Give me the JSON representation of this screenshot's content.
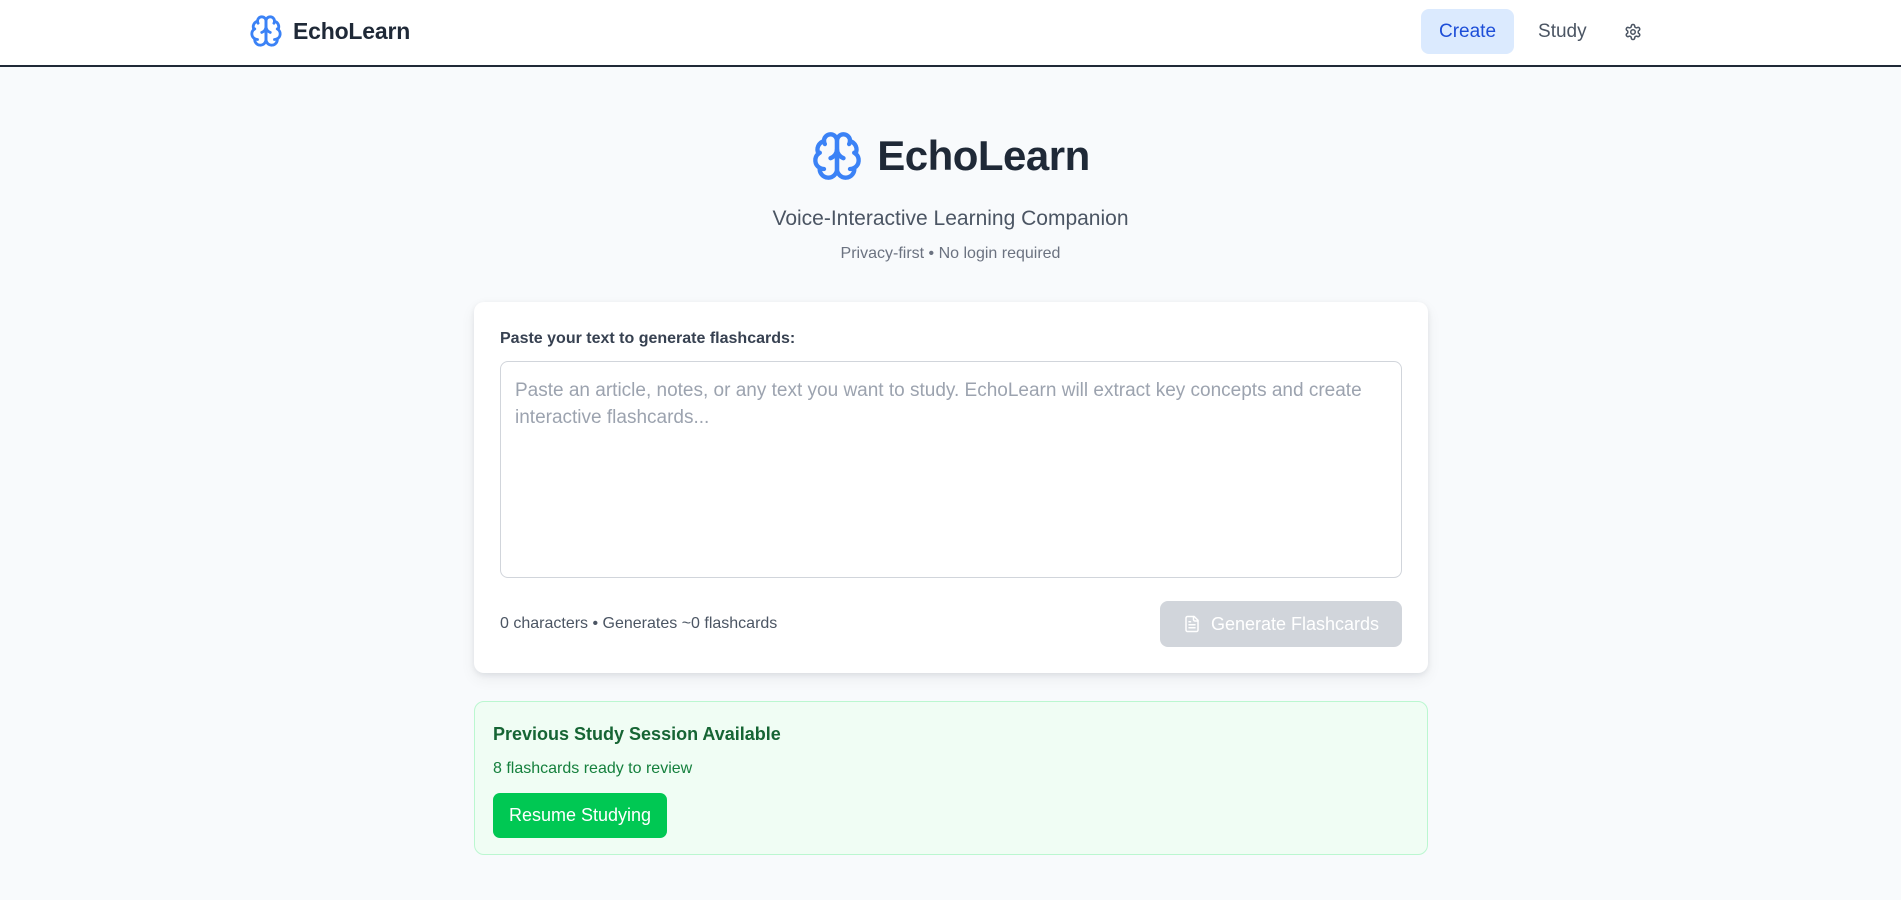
{
  "header": {
    "brand_name": "EchoLearn",
    "nav": {
      "create_label": "Create",
      "study_label": "Study"
    }
  },
  "hero": {
    "title": "EchoLearn",
    "subtitle": "Voice-Interactive Learning Companion",
    "note": "Privacy-first • No login required"
  },
  "composer": {
    "label": "Paste your text to generate flashcards:",
    "value": "",
    "placeholder": "Paste an article, notes, or any text you want to study. EchoLearn will extract key concepts and create interactive flashcards...",
    "meta": "0 characters • Generates ~0 flashcards",
    "generate_label": "Generate Flashcards"
  },
  "session": {
    "title": "Previous Study Session Available",
    "subtitle": "8 flashcards ready to review",
    "resume_label": "Resume Studying"
  },
  "icons": {
    "brand": "brain-icon",
    "settings": "gear-icon",
    "generate": "document-icon"
  },
  "colors": {
    "brand_blue": "#3b82f6",
    "active_tab_bg": "#dbeafe",
    "active_tab_text": "#1d4ed8",
    "disabled_button": "#d1d5db",
    "success_green": "#00c853",
    "panel_green_bg": "#f0fdf4"
  }
}
